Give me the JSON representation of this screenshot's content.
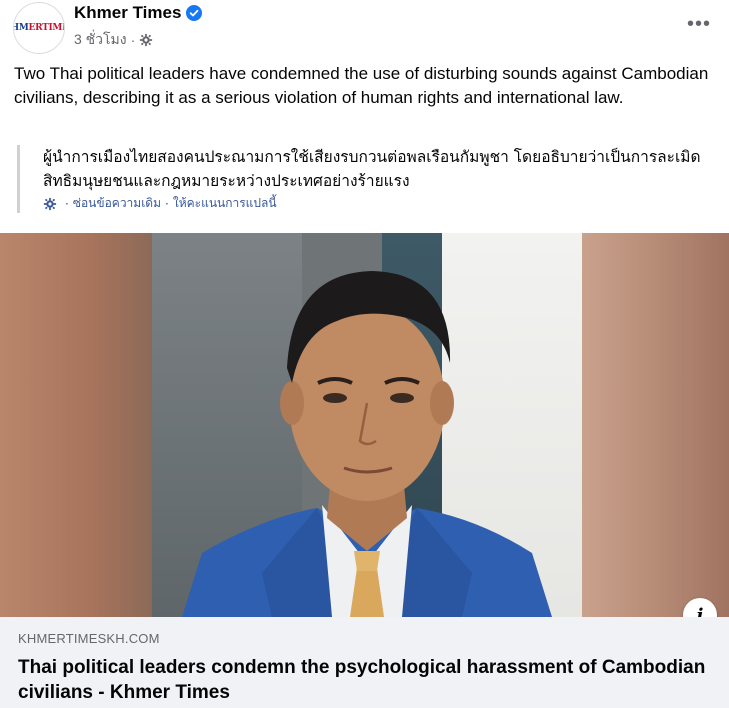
{
  "post": {
    "author": "Khmer Times",
    "avatar_text_a": "KHM",
    "avatar_text_b": "ERTIMES",
    "timestamp": "3 ชั่วโมง",
    "separator": "·",
    "more_label": "•••",
    "text": "Two Thai political leaders have condemned the use of disturbing sounds against Cambodian civilians, describing it as a serious violation of human rights and international law."
  },
  "translation": {
    "text": "ผู้นำการเมืองไทยสองคนประณามการใช้เสียงรบกวนต่อพลเรือนกัมพูชา โดยอธิบายว่าเป็นการละเมิดสิทธิมนุษยชนและกฎหมายระหว่างประเทศอย่างร้ายแรง",
    "hide_original": "ซ่อนข้อความเดิม",
    "rate_translation": "ให้คะแนนการแปลนี้",
    "separator": "·"
  },
  "image": {
    "info_label": "i"
  },
  "link_preview": {
    "domain": "KHMERTIMESKH.COM",
    "title": "Thai political leaders condemn the psychological harassment of Cambodian civilians - Khmer Times"
  },
  "colors": {
    "verified": "#1877f2",
    "link": "#385898",
    "secondary_text": "#65676b",
    "preview_bg": "#f0f2f5"
  },
  "icons": {
    "verified": "verified-badge-icon",
    "audience": "gear-icon",
    "translation": "gear-icon",
    "info": "info-icon",
    "more": "more-horizontal-icon"
  }
}
